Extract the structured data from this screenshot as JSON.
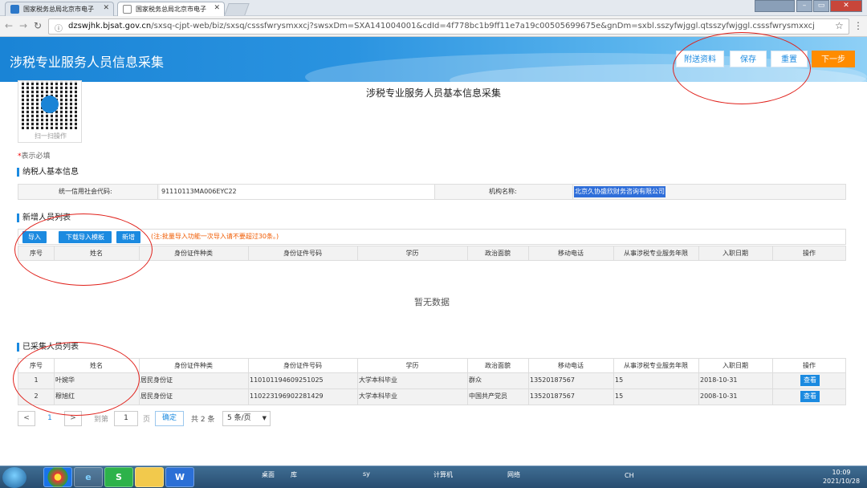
{
  "browser": {
    "tabs": [
      {
        "label": "国家税务总局北京市电子"
      },
      {
        "label": "国家税务总局北京市电子"
      }
    ],
    "url_prefix": "dzswjhk.bjsat.gov.cn",
    "url_rest": "/sxsq-cjpt-web/biz/sxsq/csssfwrysmxxcj?swsxDm=SXA141004001&cdId=4f778bc1b9ff11e7a19c00505699675e&gnDm=sxbl.sszyfwjggl.qtsszyfwjggl.csssfwrysmxxcj"
  },
  "header": {
    "title": "涉税专业服务人员信息采集",
    "buttons": {
      "attach": "附送资料",
      "save": "保存",
      "reset": "重置",
      "next": "下一步"
    }
  },
  "qr": {
    "caption": "扫一扫操作"
  },
  "main_title": "涉税专业服务人员基本信息采集",
  "required_note": "表示必填",
  "taxpayer": {
    "section_title": "纳税人基本信息",
    "credit_code_label": "统一信用社会代码:",
    "credit_code_value": "91110113MA006EYC22",
    "org_name_label": "机构名称:",
    "org_name_value": "北京久协盛欣财务咨询有限公司"
  },
  "new_list": {
    "section_title": "新增人员列表",
    "import_label": "导入",
    "download_template_label": "下载导入模板",
    "add_label": "新增",
    "note": "(注:批量导入功能一次导入请不要超过30条。)",
    "empty_text": "暂无数据"
  },
  "columns": [
    "序号",
    "姓名",
    "身份证件种类",
    "身份证件号码",
    "学历",
    "政治面貌",
    "移动电话",
    "从事涉税专业服务年限",
    "入职日期",
    "操作"
  ],
  "collected_list": {
    "section_title": "已采集人员列表",
    "view_label": "查看",
    "rows": [
      {
        "no": "1",
        "name": "叶婉华",
        "id_type": "居民身份证",
        "id_no": "110101194609251025",
        "education": "大学本科毕业",
        "political": "群众",
        "phone": "13520187567",
        "years": "15",
        "date": "2018-10-31"
      },
      {
        "no": "2",
        "name": "穆旭红",
        "id_type": "居民身份证",
        "id_no": "110223196902281429",
        "education": "大学本科毕业",
        "political": "中国共产党员",
        "phone": "13520187567",
        "years": "15",
        "date": "2008-10-31"
      }
    ]
  },
  "pager": {
    "prev": "<",
    "current": "1",
    "next": ">",
    "goto_label": "到第",
    "page_input": "1",
    "page_unit": "页",
    "confirm_label": "确定",
    "total": "共 2 条",
    "page_size": "5 条/页"
  },
  "taskbar": {
    "items": [
      {
        "label": "桌面"
      },
      {
        "label": "库"
      },
      {
        "label": "sy"
      },
      {
        "label": "计算机"
      },
      {
        "label": "网络"
      }
    ],
    "lang": "CH",
    "time": "10:09",
    "date": "2021/10/28"
  }
}
